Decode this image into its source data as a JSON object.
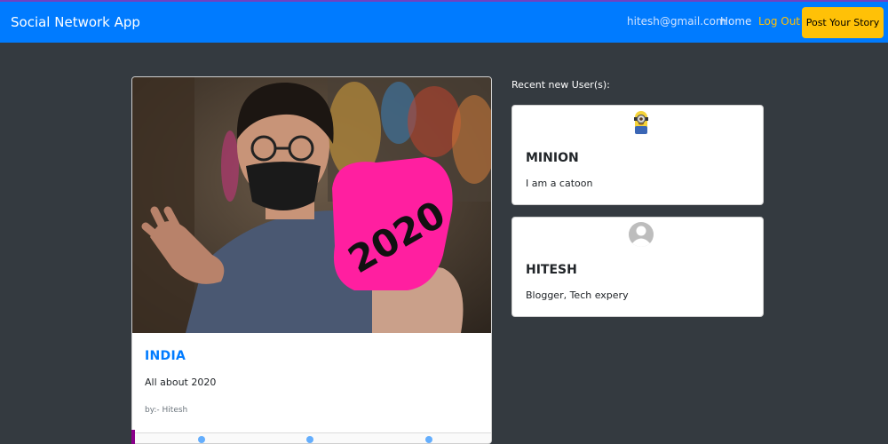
{
  "navbar": {
    "brand": "Social Network App",
    "email": "hitesh@gmail.com",
    "home": "Home",
    "logout": "Log Out",
    "post_story": "Post Your Story"
  },
  "post": {
    "image_icon": "photo-person-with-2020-sign",
    "title": "INDIA",
    "description": "All about 2020",
    "author": "by:- Hitesh"
  },
  "recent": {
    "title": "Recent new User(s):",
    "users": [
      {
        "name": "MINION",
        "bio": "I am a catoon",
        "avatar_icon": "minion-avatar"
      },
      {
        "name": "HITESH",
        "bio": "Blogger, Tech expery",
        "avatar_icon": "default-user-avatar"
      }
    ]
  },
  "colors": {
    "navbar": "#007bff",
    "background": "#343a40",
    "accent": "#ffc107",
    "title": "#007bff"
  }
}
